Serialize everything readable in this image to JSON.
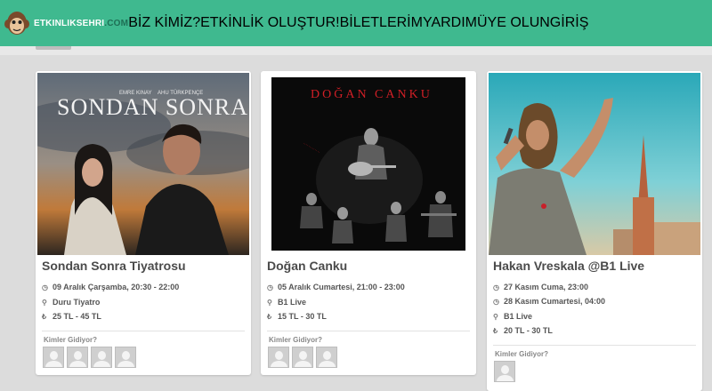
{
  "brand": {
    "name_part1": "ETKINLIKSEHRI",
    "name_part2": ".COM"
  },
  "nav": {
    "about": "BİZ KİMİZ?",
    "create": "ETKİNLİK OLUŞTUR!",
    "tickets": "BİLETLERİM",
    "help": "YARDIM",
    "signup": "ÜYE OLUN",
    "login": "GİRİŞ"
  },
  "colors": {
    "header": "#3fb98f",
    "nav_text": "#c0245a"
  },
  "events": [
    {
      "poster_title": "SONDAN SONRA",
      "poster_names": [
        "EMRE KINAY",
        "AHU TÜRKPENÇE"
      ],
      "title": "Sondan Sonra Tiyatrosu",
      "date": "09 Aralık Çarşamba, 20:30 - 22:00",
      "venue": "Duru Tiyatro",
      "price": "25 TL - 45 TL",
      "going_label": "Kimler Gidiyor?",
      "attendee_count": 4
    },
    {
      "poster_title": "DOĞAN CANKU",
      "title": "Doğan Canku",
      "date": "05 Aralık Cumartesi, 21:00 - 23:00",
      "venue": "B1 Live",
      "price": "15 TL - 30 TL",
      "going_label": "Kimler Gidiyor?",
      "attendee_count": 3
    },
    {
      "title": "Hakan Vreskala @B1 Live",
      "date": "27 Kasım Cuma, 23:00",
      "date2": "28 Kasım Cumartesi, 04:00",
      "venue": "B1 Live",
      "price": "20 TL - 30 TL",
      "going_label": "Kimler Gidiyor?",
      "attendee_count": 1
    }
  ],
  "icons": {
    "clock": "clock-icon",
    "pin": "map-pin-icon",
    "lira": "lira-icon"
  }
}
